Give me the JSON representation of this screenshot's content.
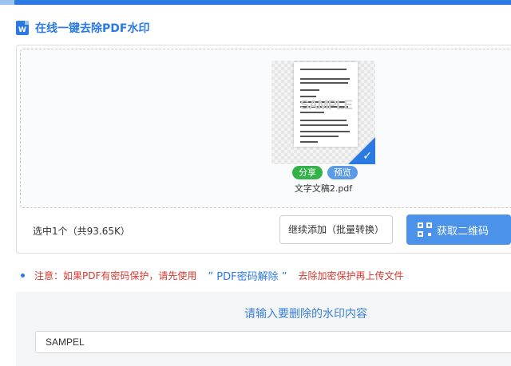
{
  "header": {
    "icon": "word-doc-icon",
    "icon_letter": "W",
    "title": "在线一键去除PDF水印"
  },
  "file": {
    "thumbnail_watermark": "SAMPLE",
    "share_label": "分享",
    "preview_label": "预览",
    "name": "文字文稿2.pdf"
  },
  "summary": "选中1个（共93.65K）",
  "actions": {
    "add_more_label": "继续添加（批量转换）",
    "qr_label": "获取二维码",
    "qr_icon": "qr-code-icon"
  },
  "notice": {
    "prefix": "注意：如果PDF有密码保护，请先使用",
    "link": "” PDF密码解除 ”",
    "suffix": "去除加密保护再上传文件"
  },
  "watermark": {
    "prompt": "请输入要删除的水印内容",
    "value": "SAMPEL"
  },
  "colors": {
    "accent": "#2a7ae2",
    "share": "#35b14a",
    "warning_text": "#d6372d"
  }
}
